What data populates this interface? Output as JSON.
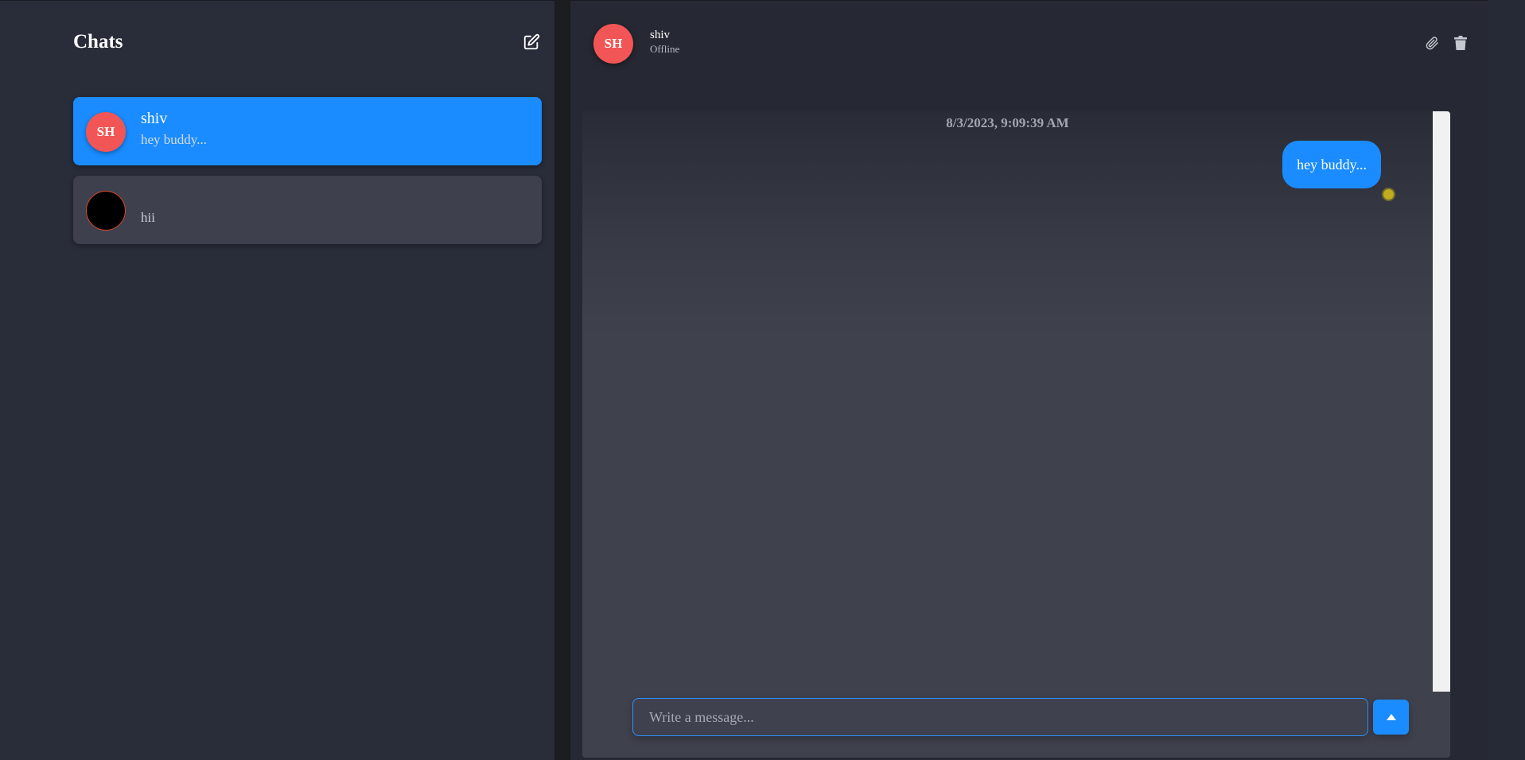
{
  "sidebar": {
    "title": "Chats",
    "compose_icon": "edit-square-icon",
    "chats": [
      {
        "initials": "SH",
        "name": "shiv",
        "preview": "hey buddy...",
        "active": true,
        "avatar_color": "#f25555"
      },
      {
        "initials": "",
        "name": "",
        "preview": "hii",
        "active": false,
        "avatar_color": "#000000"
      }
    ]
  },
  "header": {
    "initials": "SH",
    "name": "shiv",
    "status": "Offline",
    "attach_icon": "paperclip-icon",
    "delete_icon": "trash-icon"
  },
  "conversation": {
    "timestamp": "8/3/2023, 9:09:39 AM",
    "messages": [
      {
        "text": "hey buddy...",
        "outgoing": true,
        "read_indicator_color": "#bfac1f"
      }
    ]
  },
  "composer": {
    "placeholder": "Write a message...",
    "value": "",
    "send_icon": "triangle-up-icon"
  },
  "colors": {
    "accent": "#1a8cff",
    "avatar_red": "#f25555",
    "background": "#262a36",
    "card": "#3e404d"
  }
}
